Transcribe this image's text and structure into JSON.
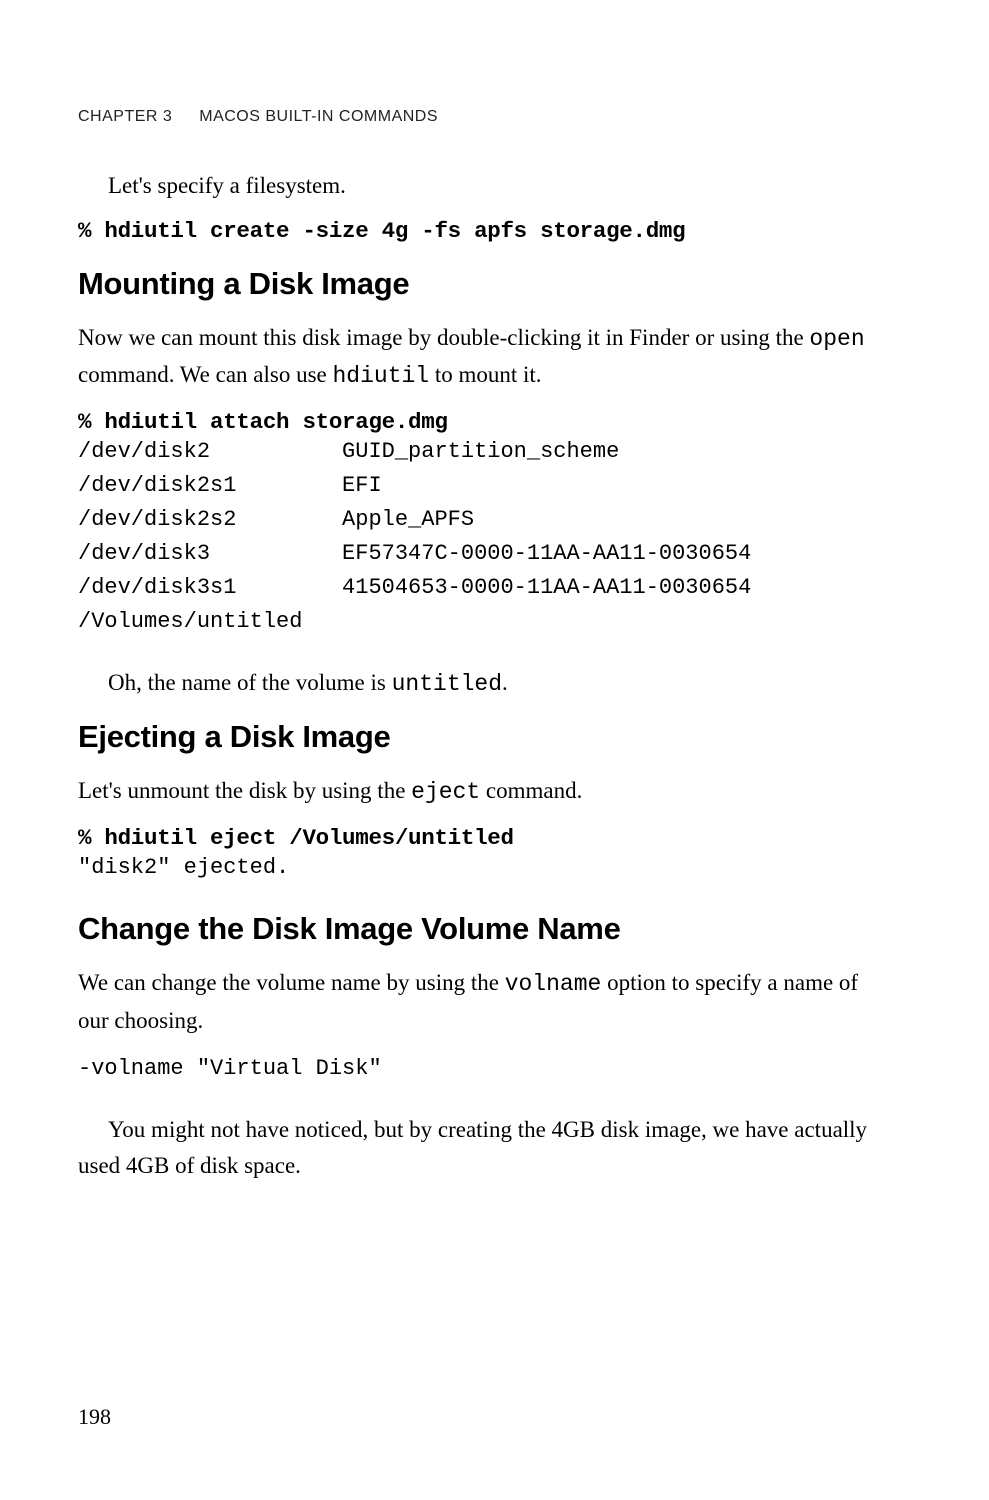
{
  "header": {
    "chapter": "CHAPTER 3",
    "title": "MACOS BUILT-IN COMMANDS"
  },
  "p1_a": "Let's specify a filesystem.",
  "cmd1": "% hdiutil create -size 4g -fs apfs storage.dmg",
  "h1": "Mounting a Disk Image",
  "p2_a": "Now we can mount this disk image by double-clicking it in Finder or using the ",
  "p2_b": "open",
  "p2_c": " command. We can also use ",
  "p2_d": "hdiutil",
  "p2_e": " to mount it.",
  "cmd2": "% hdiutil attach storage.dmg",
  "out2": "/dev/disk2          GUID_partition_scheme\n/dev/disk2s1        EFI\n/dev/disk2s2        Apple_APFS\n/dev/disk3          EF57347C-0000-11AA-AA11-0030654\n/dev/disk3s1        41504653-0000-11AA-AA11-0030654 \n/Volumes/untitled",
  "p3_a": "Oh, the name of the volume is ",
  "p3_b": "untitled",
  "p3_c": ".",
  "h2": "Ejecting a Disk Image",
  "p4_a": "Let's unmount the disk by using the ",
  "p4_b": "eject",
  "p4_c": " command.",
  "cmd3": "% hdiutil eject /Volumes/untitled",
  "out3": "\"disk2\" ejected.",
  "h3": "Change the Disk Image Volume Name",
  "p5_a": "We can change the volume name by using the ",
  "p5_b": "volname",
  "p5_c": " option to specify a name of our choosing.",
  "cmd4": "-volname \"Virtual Disk\"",
  "p6_a": "You might not have noticed, but by creating the 4GB disk image, we have actually used 4GB of disk space.",
  "pageNumber": "198"
}
